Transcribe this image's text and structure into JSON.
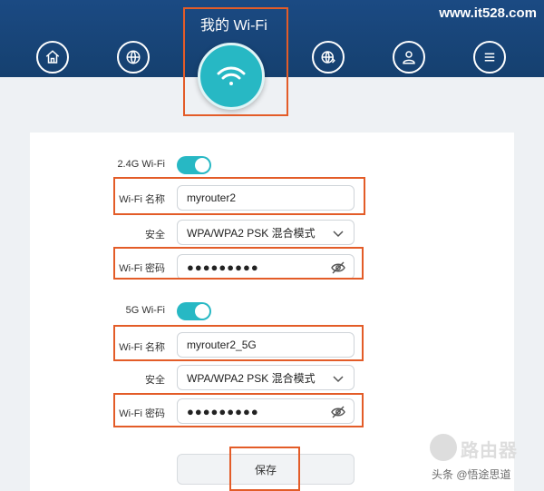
{
  "site_url": "www.it528.com",
  "nav": {
    "title": "我的 Wi-Fi",
    "icons": [
      "home-icon",
      "globe-icon",
      "wifi-icon",
      "globe-settings-icon",
      "user-icon",
      "menu-icon"
    ]
  },
  "wifi24": {
    "section_label": "2.4G Wi-Fi",
    "toggle_on": true,
    "name_label": "Wi-Fi 名称",
    "name_value": "myrouter2",
    "security_label": "安全",
    "security_value": "WPA/WPA2 PSK 混合模式",
    "password_label": "Wi-Fi 密码",
    "password_value": "●●●●●●●●●"
  },
  "wifi5": {
    "section_label": "5G Wi-Fi",
    "toggle_on": true,
    "name_label": "Wi-Fi 名称",
    "name_value": "myrouter2_5G",
    "security_label": "安全",
    "security_value": "WPA/WPA2 PSK 混合模式",
    "password_label": "Wi-Fi 密码",
    "password_value": "●●●●●●●●●"
  },
  "save_label": "保存",
  "watermark": {
    "title": "路由器",
    "subtitle": "头条 @悟途思道"
  },
  "colors": {
    "header": "#1b4a83",
    "accent": "#27b8c4",
    "highlight": "#e35c28"
  }
}
